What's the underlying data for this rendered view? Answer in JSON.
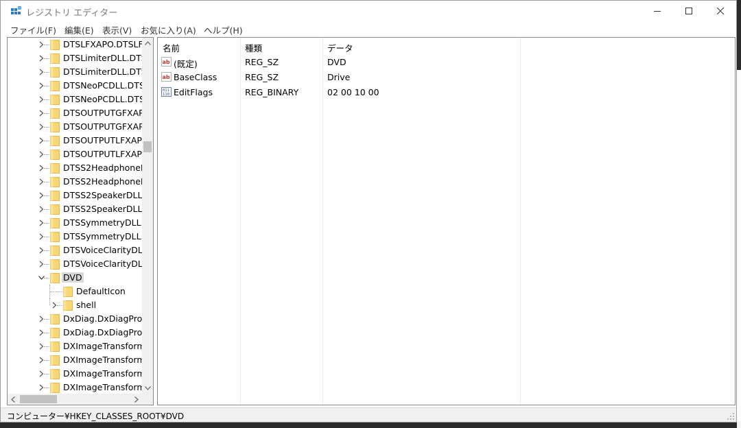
{
  "window": {
    "title": "レジストリ エディター"
  },
  "menu": [
    "ファイル(F)",
    "編集(E)",
    "表示(V)",
    "お気に入り(A)",
    "ヘルプ(H)"
  ],
  "tree": {
    "items": [
      {
        "label": "DTSLFXAPO.DTSLF",
        "level": 0,
        "expander": "collapsed"
      },
      {
        "label": "DTSLimiterDLL.DTS",
        "level": 0,
        "expander": "collapsed"
      },
      {
        "label": "DTSLimiterDLL.DTS",
        "level": 0,
        "expander": "collapsed"
      },
      {
        "label": "DTSNeoPCDLL.DTS",
        "level": 0,
        "expander": "collapsed"
      },
      {
        "label": "DTSNeoPCDLL.DTS",
        "level": 0,
        "expander": "collapsed"
      },
      {
        "label": "DTSOUTPUTGFXAP",
        "level": 0,
        "expander": "collapsed"
      },
      {
        "label": "DTSOUTPUTGFXAP",
        "level": 0,
        "expander": "collapsed"
      },
      {
        "label": "DTSOUTPUTLFXAP(",
        "level": 0,
        "expander": "collapsed"
      },
      {
        "label": "DTSOUTPUTLFXAP(",
        "level": 0,
        "expander": "collapsed"
      },
      {
        "label": "DTSS2HeadphoneD",
        "level": 0,
        "expander": "collapsed"
      },
      {
        "label": "DTSS2HeadphoneD",
        "level": 0,
        "expander": "collapsed"
      },
      {
        "label": "DTSS2SpeakerDLL.",
        "level": 0,
        "expander": "collapsed"
      },
      {
        "label": "DTSS2SpeakerDLL.",
        "level": 0,
        "expander": "collapsed"
      },
      {
        "label": "DTSSymmetryDLL.",
        "level": 0,
        "expander": "collapsed"
      },
      {
        "label": "DTSSymmetryDLL.",
        "level": 0,
        "expander": "collapsed"
      },
      {
        "label": "DTSVoiceClarityDLL",
        "level": 0,
        "expander": "collapsed"
      },
      {
        "label": "DTSVoiceClarityDLL",
        "level": 0,
        "expander": "collapsed"
      },
      {
        "label": "DVD",
        "level": 0,
        "expander": "expanded",
        "selected": true
      },
      {
        "label": "DefaultIcon",
        "level": 1,
        "expander": "none"
      },
      {
        "label": "shell",
        "level": 1,
        "expander": "collapsed"
      },
      {
        "label": "DxDiag.DxDiagProv",
        "level": 0,
        "expander": "collapsed"
      },
      {
        "label": "DxDiag.DxDiagProv",
        "level": 0,
        "expander": "collapsed"
      },
      {
        "label": "DXImageTransform",
        "level": 0,
        "expander": "collapsed"
      },
      {
        "label": "DXImageTransform",
        "level": 0,
        "expander": "collapsed"
      },
      {
        "label": "DXImageTransform",
        "level": 0,
        "expander": "collapsed"
      },
      {
        "label": "DXImageTransform",
        "level": 0,
        "expander": "collapsed"
      }
    ]
  },
  "list": {
    "columns": [
      "名前",
      "種類",
      "データ"
    ],
    "rows": [
      {
        "icon": "string-value-icon",
        "name": "(既定)",
        "type": "REG_SZ",
        "data": "DVD"
      },
      {
        "icon": "string-value-icon",
        "name": "BaseClass",
        "type": "REG_SZ",
        "data": "Drive"
      },
      {
        "icon": "binary-value-icon",
        "name": "EditFlags",
        "type": "REG_BINARY",
        "data": "02 00 10 00"
      }
    ]
  },
  "status": {
    "path": "コンピューター¥HKEY_CLASSES_ROOT¥DVD"
  },
  "colors": {
    "folder": "#f8d775",
    "selection": "#d9d9d9",
    "accent": "#0078d7"
  }
}
